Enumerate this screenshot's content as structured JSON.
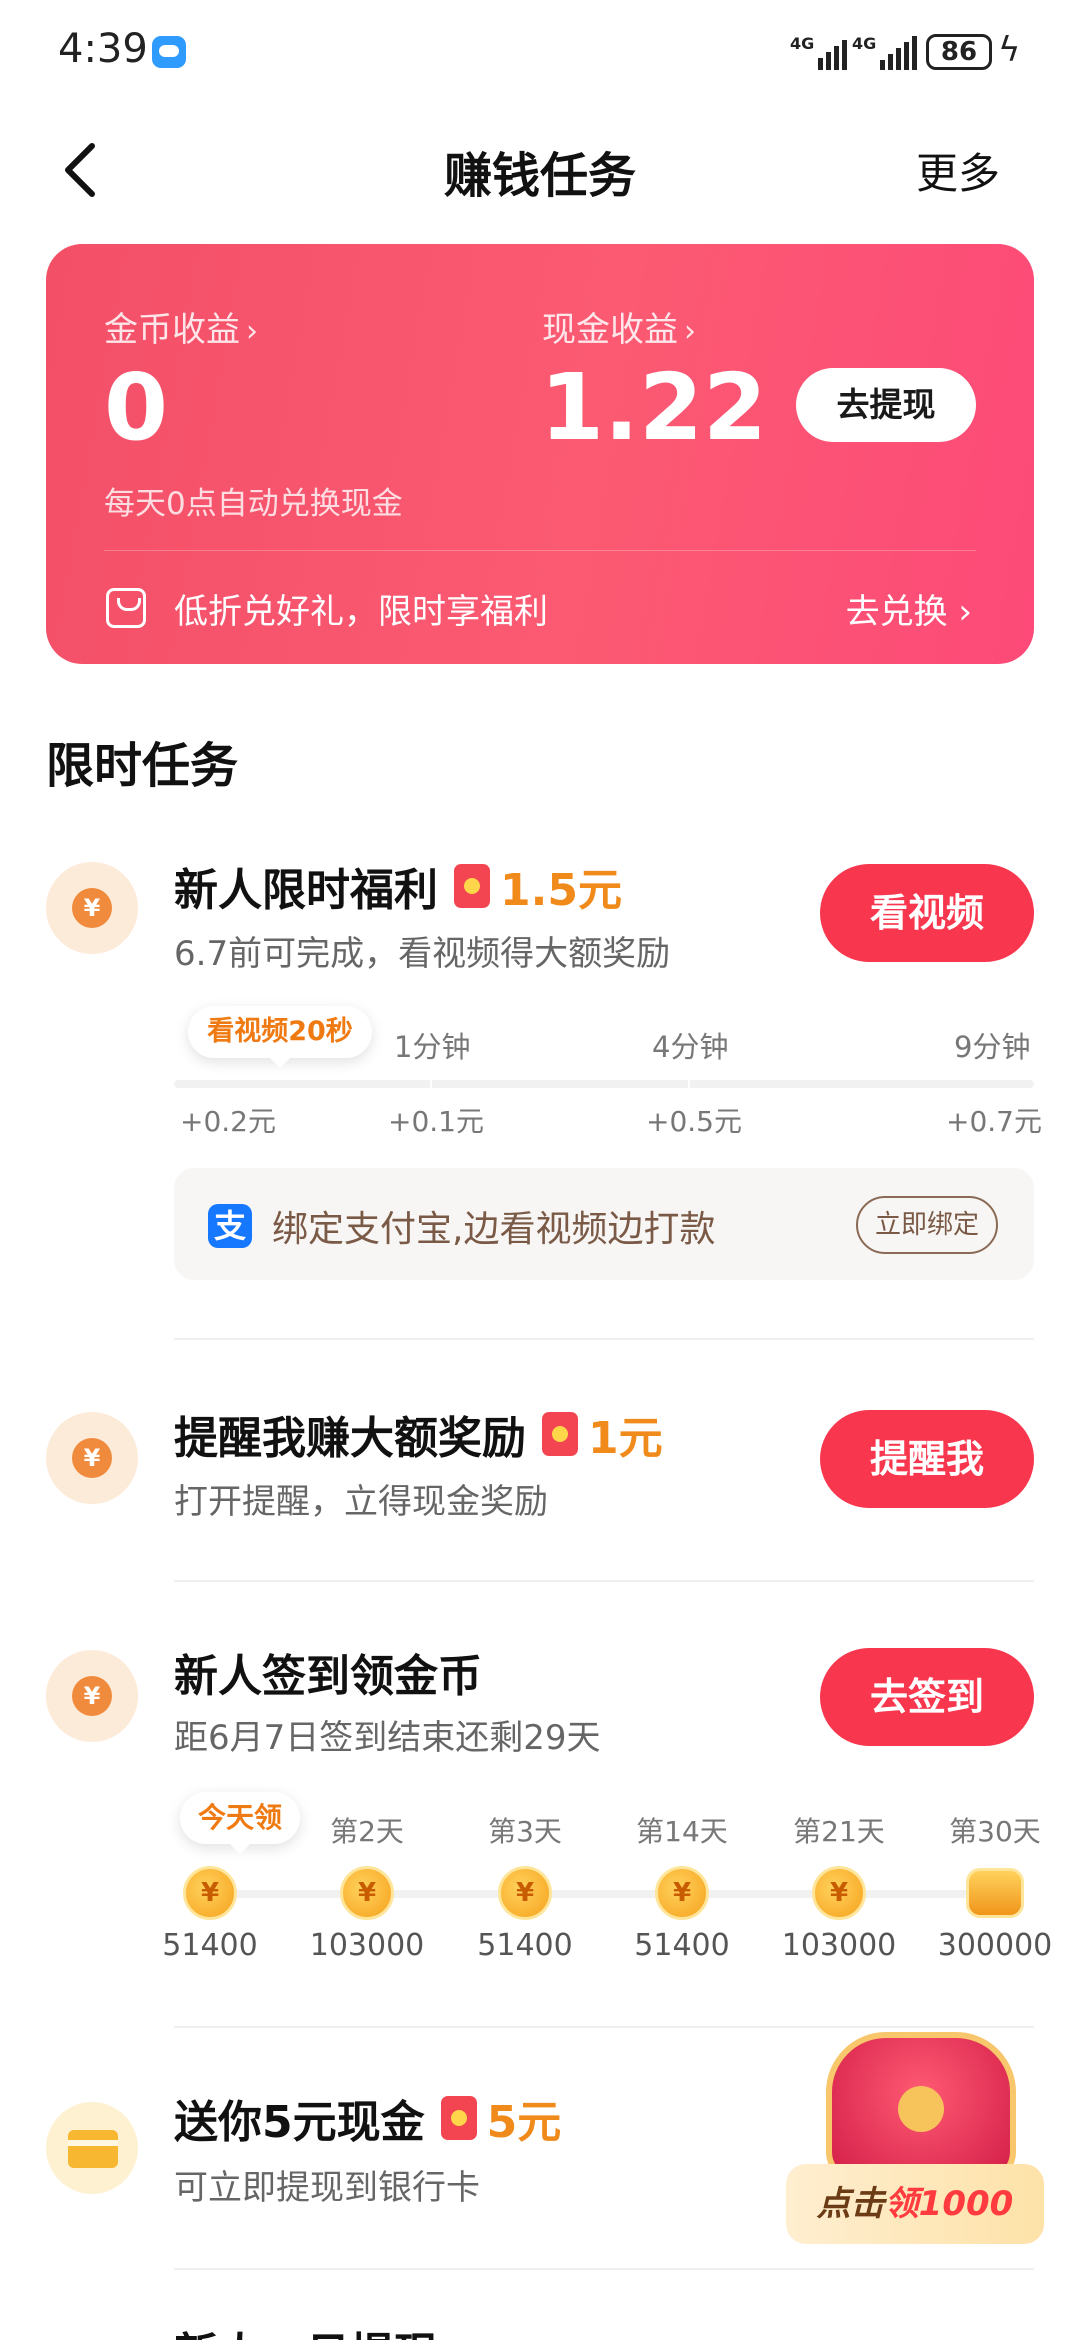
{
  "status_bar": {
    "time": "4:39",
    "signal1": "4G",
    "signal2": "4G",
    "battery": "86"
  },
  "nav": {
    "title": "赚钱任务",
    "more": "更多"
  },
  "earnings": {
    "coin_label": "金币收益",
    "coin_value": "0",
    "cash_label": "现金收益",
    "cash_value": "1.22",
    "withdraw_button": "去提现",
    "note": "每天0点自动兑换现金",
    "promo_text": "低折兑好礼，限时享福利",
    "exchange_link": "去兑换",
    "colors": {
      "card": "#f35068",
      "accent": "#f8374f"
    }
  },
  "section_title": "限时任务",
  "tasks": [
    {
      "title": "新人限时福利",
      "reward": "1.5元",
      "subtitle": "6.7前可完成，看视频得大额奖励",
      "button": "看视频",
      "progress": {
        "tip": "看视频20秒",
        "labels": [
          "1分钟",
          "4分钟",
          "9分钟"
        ],
        "rewards": [
          "+0.2元",
          "+0.1元",
          "+0.5元",
          "+0.7元"
        ]
      },
      "alipay": {
        "icon": "支",
        "text": "绑定支付宝,边看视频边打款",
        "button": "立即绑定"
      }
    },
    {
      "title": "提醒我赚大额奖励",
      "reward": "1元",
      "subtitle": "打开提醒，立得现金奖励",
      "button": "提醒我"
    },
    {
      "title": "新人签到领金币",
      "subtitle": "距6月7日签到结束还剩29天",
      "button": "去签到",
      "days": {
        "tip": "今天领",
        "labels": [
          "第2天",
          "第3天",
          "第14天",
          "第21天",
          "第30天"
        ],
        "amounts": [
          "51400",
          "103000",
          "51400",
          "51400",
          "103000",
          "300000"
        ],
        "coin_glyph": "¥"
      }
    },
    {
      "title": "送你5元现金",
      "reward": "5元",
      "subtitle": "可立即提现到银行卡"
    }
  ],
  "float_badge": {
    "prefix": "点击",
    "highlight": "领1000"
  },
  "bottom_peek": "新人一日提现"
}
